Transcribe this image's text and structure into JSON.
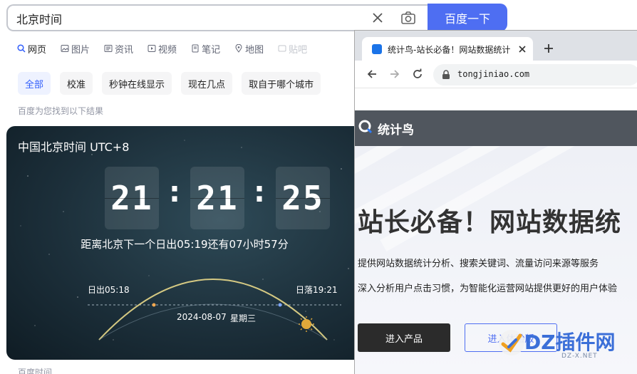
{
  "search": {
    "query": "北京时间",
    "button_label": "百度一下"
  },
  "tabs": [
    {
      "label": "网页",
      "icon": "search-icon",
      "active": true
    },
    {
      "label": "图片",
      "icon": "image-icon"
    },
    {
      "label": "资讯",
      "icon": "news-icon"
    },
    {
      "label": "视频",
      "icon": "video-icon"
    },
    {
      "label": "笔记",
      "icon": "note-icon"
    },
    {
      "label": "地图",
      "icon": "map-icon"
    },
    {
      "label": "贴吧",
      "icon": "tieba-icon"
    }
  ],
  "chips": [
    "全部",
    "校准",
    "秒钟在线显示",
    "现在几点",
    "取自于哪个城市"
  ],
  "result_count": "百度为您找到以下结果",
  "clock": {
    "title": "中国北京时间 UTC+8",
    "hours": "21",
    "minutes": "21",
    "seconds": "25",
    "colon": ":",
    "note": "距离北京下一个日出05:19还有07小时57分",
    "sunrise": "日出05:18",
    "sunset": "日落19:21",
    "date": "2024-08-07",
    "weekday": "星期三"
  },
  "footer_label": "百度时间",
  "browser": {
    "tab_title": "统计鸟-站长必备！网站数据统计",
    "url": "tongjiniao.com",
    "site_name": "统计鸟",
    "hero_title": "站长必备！网站数据统",
    "hero_line1": "提供网站数据统计分析、搜索关键词、流量访问来源等服务",
    "hero_line2": "深入分析用户点击习惯，为智能化运营网站提供更好的用户体验",
    "enter_button": "进入产品",
    "trial_button": "进入体验版"
  },
  "watermark": {
    "text": "DZ插件网",
    "sub": "DZ-X.NET"
  },
  "colors": {
    "baidu_blue": "#4e6ef2",
    "card_bg": "#1c2f3a",
    "site_header": "#50565e"
  }
}
